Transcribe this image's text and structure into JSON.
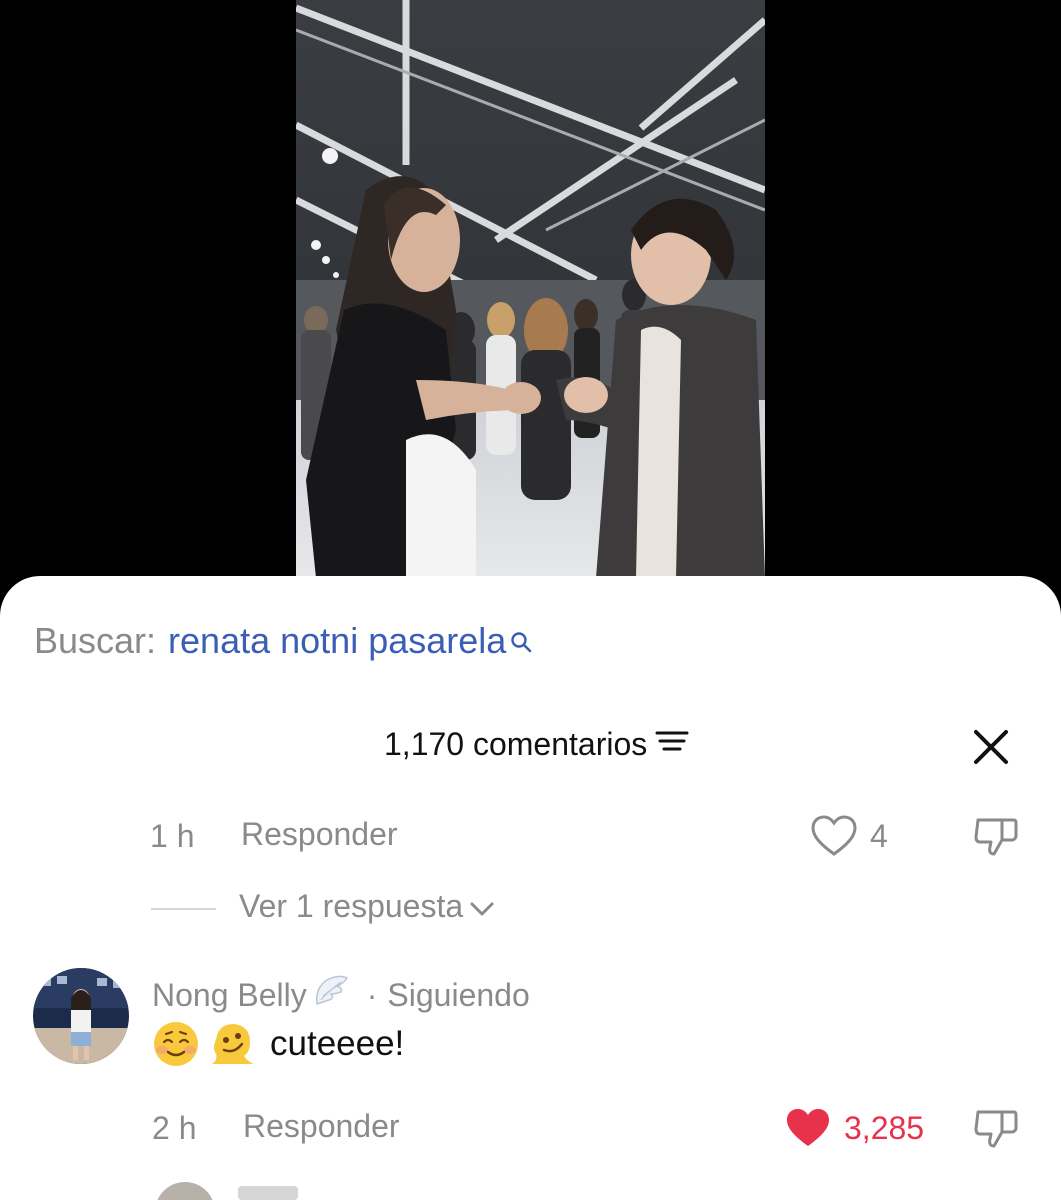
{
  "video": {
    "description_icon": "video-frame"
  },
  "search": {
    "prefix": "Buscar:",
    "query": "renata notni pasarela",
    "icon": "search-icon"
  },
  "header": {
    "title": "1,170 comentarios",
    "sort_icon": "sort-icon",
    "close_icon": "close-icon"
  },
  "reply_comment": {
    "time": "1 h",
    "reply_label": "Responder",
    "like_count": "4",
    "liked": false
  },
  "view_replies": {
    "label": "Ver 1 respuesta"
  },
  "comment": {
    "username": "Nong Belly",
    "badge_icon": "angel-wing-icon",
    "dot": "·",
    "follow_status": "Siguiendo",
    "emojis": [
      "smiling-face-icon",
      "melting-face-icon"
    ],
    "text": "cuteeee!",
    "time": "2 h",
    "reply_label": "Responder",
    "like_count": "3,285",
    "liked": true
  },
  "colors": {
    "accent_red": "#e8324b",
    "link_blue": "#3a5db5",
    "muted_gray": "#8a8a8a"
  }
}
